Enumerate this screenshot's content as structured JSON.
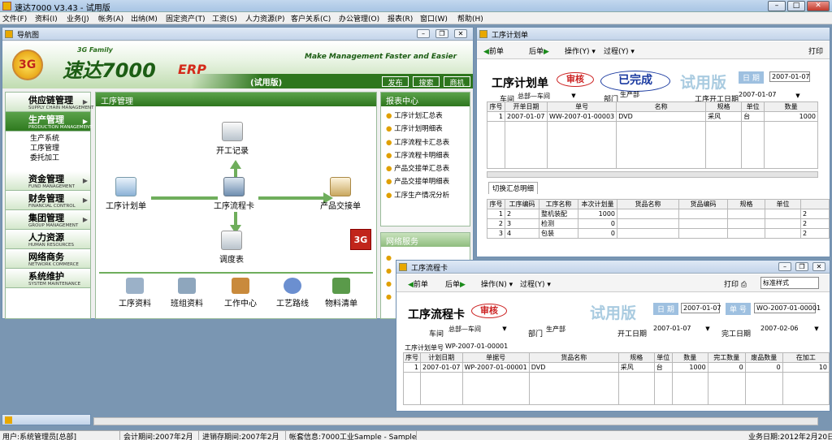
{
  "app": {
    "title": "速达7000 V3.43 - 试用版"
  },
  "menu": [
    "文件(F)",
    "资料(I)",
    "业务(J)",
    "帐务(A)",
    "出纳(M)",
    "固定资产(T)",
    "工资(S)",
    "人力资源(P)",
    "客户关系(C)",
    "办公管理(O)",
    "报表(R)",
    "窗口(W)",
    "帮助(H)"
  ],
  "nav": {
    "title": "导航图",
    "brand_small": "3G Family",
    "brand": "速达7000",
    "brand_erp": "ERP",
    "trial": "(试用版)",
    "slogan": "Make Management Faster and Easier",
    "top_buttons": [
      "发布",
      "搜索",
      "商机"
    ],
    "sections": [
      {
        "zh": "供应链管理",
        "en": "SUPPLY CHAIN MANAGEMENT"
      },
      {
        "zh": "生产管理",
        "en": "PRODUCTION MANAGEMENT"
      },
      {
        "zh": "资金管理",
        "en": "FUND MANAGEMENT"
      },
      {
        "zh": "财务管理",
        "en": "FINANCIAL CONTROL"
      },
      {
        "zh": "集团管理",
        "en": "GROUP MANAGEMENT"
      },
      {
        "zh": "人力资源",
        "en": "HUMAN RESOURCES"
      },
      {
        "zh": "网络商务",
        "en": "NETWORK COMMERCE"
      },
      {
        "zh": "系统维护",
        "en": "SYSTEM MAINTENANCE"
      }
    ],
    "sub_items": [
      "生产系统",
      "工序管理",
      "委托加工"
    ],
    "panel_title": "工序管理",
    "flow": {
      "start": "开工记录",
      "plan": "工序计划单",
      "card": "工序流程卡",
      "handover": "产品交接单",
      "dispatch": "调度表"
    },
    "bottom_icons": [
      "工序资料",
      "班组资料",
      "工作中心",
      "工艺路线",
      "物料清单"
    ],
    "report_title": "报表中心",
    "reports": [
      "工序计划汇总表",
      "工序计划明细表",
      "工序流程卡汇总表",
      "工序流程卡明细表",
      "产品交接单汇总表",
      "产品交接单明细表",
      "工序生产情况分析"
    ],
    "net_title": "网络服务",
    "badge": "3G"
  },
  "plan": {
    "title": "工序计划单",
    "toolbar": {
      "prev": "前单",
      "next": "后单",
      "op": "操作(Y)",
      "proc": "过程(Y)",
      "print": "打印"
    },
    "doc_title": "工序计划单",
    "stamp_audit": "审核",
    "stamp_done": "已完成",
    "trial": "试用版",
    "date_label": "日 期",
    "date": "2007-01-07",
    "workshop_label": "车间",
    "workshop": "总部—车间",
    "dept_label": "部门",
    "dept": "生产部",
    "start_label": "工序开工日期",
    "start": "2007-01-07",
    "columns": [
      "序号",
      "开单日期",
      "单号",
      "名称",
      "规格",
      "单位",
      "数量"
    ],
    "rows": [
      {
        "no": "1",
        "date": "2007-01-07",
        "code": "WW-2007-01-00003",
        "name": "DVD",
        "spec": "采风",
        "unit": "台",
        "qty": "1000"
      }
    ],
    "tab": "切换汇总明细",
    "sub_columns": [
      "序号",
      "工序编码",
      "工序名称",
      "本次计划量",
      "货品名称",
      "货品编码",
      "规格",
      "单位"
    ],
    "sub_rows": [
      {
        "no": "1",
        "code": "2",
        "name": "整机装配",
        "qty": "1000",
        "tail": "2"
      },
      {
        "no": "2",
        "code": "3",
        "name": "检测",
        "qty": "0",
        "tail": "2"
      },
      {
        "no": "3",
        "code": "4",
        "name": "包装",
        "qty": "0",
        "tail": "2"
      }
    ]
  },
  "card": {
    "title": "工序流程卡",
    "toolbar": {
      "prev": "前单",
      "next": "后单",
      "op": "操作(N)",
      "proc": "过程(Y)",
      "print": "打印",
      "style": "标准样式"
    },
    "doc_title": "工序流程卡",
    "stamp_audit": "审核",
    "trial": "试用版",
    "date_label": "日 期",
    "date": "2007-01-07",
    "no_label": "单 号",
    "no": "WO-2007-01-00001",
    "workshop_label": "车间",
    "workshop": "总部—车间",
    "dept_label": "部门",
    "dept": "生产部",
    "start_label": "开工日期",
    "start": "2007-01-07",
    "end_label": "完工日期",
    "end": "2007-02-06",
    "plan_no_label": "工序计划单号",
    "plan_no": "WP-2007-01-00001",
    "columns": [
      "序号",
      "计划日期",
      "单据号",
      "货品名称",
      "规格",
      "单位",
      "数量",
      "完工数量",
      "废品数量",
      "在加工"
    ],
    "rows": [
      {
        "no": "1",
        "date": "2007-01-07",
        "code": "WP-2007-01-00001",
        "name": "DVD",
        "spec": "采风",
        "unit": "台",
        "qty": "1000",
        "done": "0",
        "waste": "0",
        "wip": "10"
      }
    ]
  },
  "status": {
    "user": "用户:系统管理员[总部]",
    "period": "会计期间:2007年2月",
    "stock_period": "进销存期间:2007年2月",
    "account": "帐套信息:7000工业Sample - Sample",
    "biz_date": "业务日期:2012年2月20日"
  },
  "colors": {
    "green": "#2e761e",
    "red_stamp": "#cc2222",
    "blue_stamp": "#1a3aa0",
    "trial": "#a9cbe0"
  }
}
